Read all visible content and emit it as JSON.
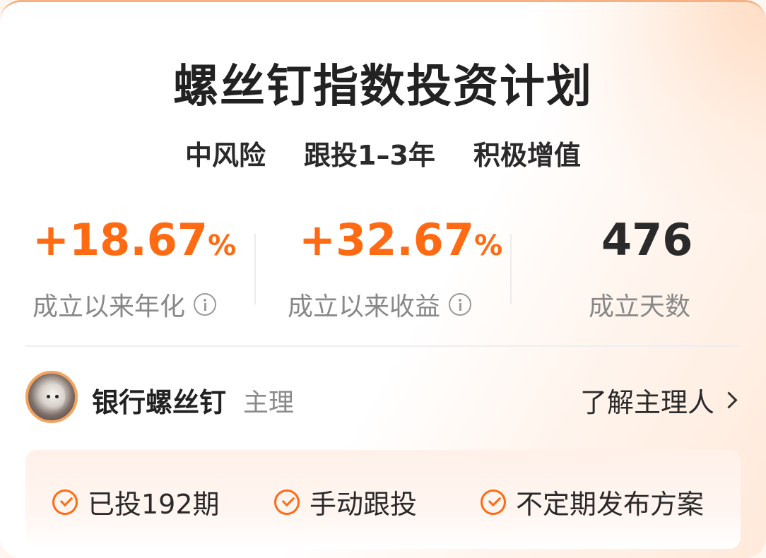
{
  "plan": {
    "title": "螺丝钉指数投资计划",
    "tags": [
      "中风险",
      "跟投1–3年",
      "积极增值"
    ]
  },
  "stats": [
    {
      "value": "+18.67",
      "unit": "%",
      "label": "成立以来年化",
      "has_info": true,
      "color": "#ff6a13"
    },
    {
      "value": "+32.67",
      "unit": "%",
      "label": "成立以来收益",
      "has_info": true,
      "color": "#ff6a13"
    },
    {
      "value": "476",
      "unit": "",
      "label": "成立天数",
      "has_info": false,
      "color": "#2a2a2a"
    }
  ],
  "manager": {
    "name": "银行螺丝钉",
    "role": "主理",
    "link_label": "了解主理人",
    "link_icon": "chevron-right-icon",
    "avatar_icon": "dog-avatar"
  },
  "features": [
    {
      "label": "已投192期",
      "icon": "check-circle-icon"
    },
    {
      "label": "手动跟投",
      "icon": "check-circle-icon"
    },
    {
      "label": "不定期发布方案",
      "icon": "check-circle-icon"
    }
  ],
  "colors": {
    "accent": "#ff6a13",
    "text": "#222222",
    "muted": "#888888",
    "tag_highlight": "#fde3d2"
  }
}
